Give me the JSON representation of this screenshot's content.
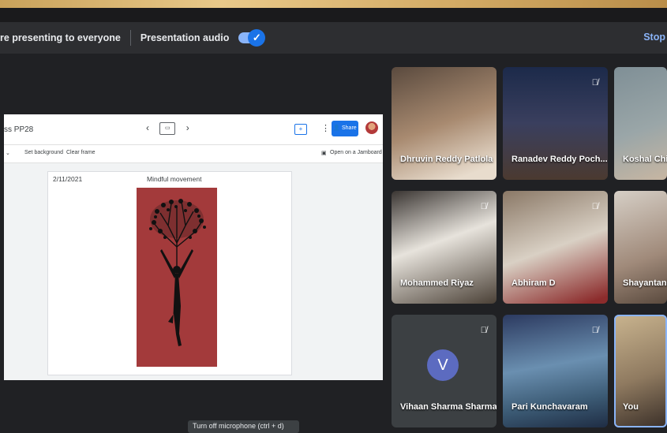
{
  "presentation_bar": {
    "status_text": "re presenting to everyone",
    "audio_label": "Presentation audio",
    "audio_toggle_icon": "check-icon",
    "stop_label": "Stop"
  },
  "slides_app": {
    "doc_title": "ss PP28",
    "toolbar_items": [
      "Set background",
      "Clear frame"
    ],
    "jamboard_label": "Open on a Jamboard",
    "share_label": "Share",
    "slide": {
      "date": "2/11/2021",
      "title": "Mindful movement"
    }
  },
  "participants": [
    {
      "name": "Dhruvin Reddy Patlola",
      "muted": false
    },
    {
      "name": "Ranadev Reddy Poch...",
      "muted": true
    },
    {
      "name": "Koshal Chit",
      "muted": false
    },
    {
      "name": "Mohammed Riyaz",
      "muted": true
    },
    {
      "name": "Abhiram D",
      "muted": true
    },
    {
      "name": "Shayantani",
      "muted": false
    },
    {
      "name": "Vihaan Sharma Sharma",
      "initial": "V",
      "muted": true
    },
    {
      "name": "Pari Kunchavaram",
      "muted": true
    },
    {
      "name": "You",
      "muted": false
    }
  ],
  "tooltip": "Turn off microphone (ctrl + d)",
  "colors": {
    "accent": "#8ab4f8",
    "art_bg": "#a33a3b",
    "avatar_bg": "#5c6bc0"
  }
}
